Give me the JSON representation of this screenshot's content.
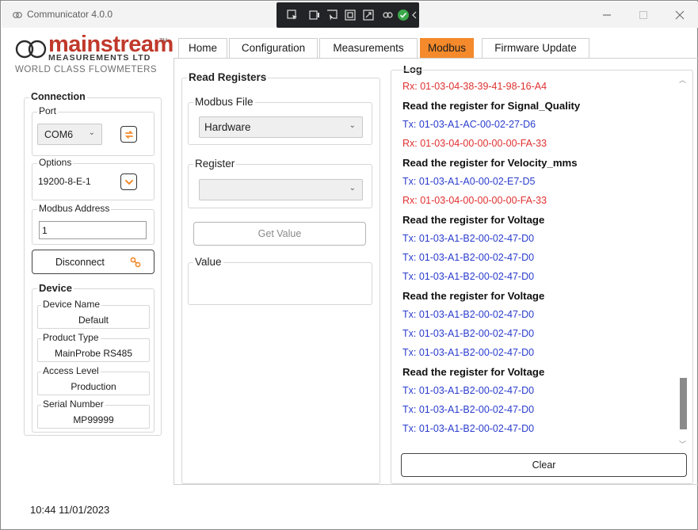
{
  "window": {
    "title": "Communicator 4.0.0"
  },
  "logo": {
    "brand": "mainstream",
    "trademark": "TM",
    "subtitle": "MEASUREMENTS LTD",
    "tagline": "WORLD CLASS FLOWMETERS"
  },
  "tabs": [
    {
      "label": "Home",
      "active": false
    },
    {
      "label": "Configuration",
      "active": false
    },
    {
      "label": "Measurements",
      "active": false
    },
    {
      "label": "Modbus",
      "active": true
    },
    {
      "label": "Firmware Update",
      "active": false
    }
  ],
  "connection": {
    "title": "Connection",
    "port_label": "Port",
    "port_value": "COM6",
    "options_label": "Options",
    "options_value": "19200-8-E-1",
    "address_label": "Modbus Address",
    "address_value": "1",
    "disconnect_label": "Disconnect"
  },
  "device": {
    "title": "Device",
    "fields": [
      {
        "label": "Device Name",
        "value": "Default"
      },
      {
        "label": "Product Type",
        "value": "MainProbe RS485"
      },
      {
        "label": "Access Level",
        "value": "Production"
      },
      {
        "label": "Serial Number",
        "value": "MP99999"
      }
    ]
  },
  "read_registers": {
    "title": "Read Registers",
    "modbus_file_label": "Modbus File",
    "modbus_file_value": "Hardware",
    "register_label": "Register",
    "register_value": "",
    "get_value_label": "Get Value",
    "value_label": "Value"
  },
  "log": {
    "title": "Log",
    "lines": [
      {
        "type": "rx",
        "text": "Rx: 01-03-04-38-39-41-98-16-A4"
      },
      {
        "type": "heading",
        "text": "Read the register for Signal_Quality"
      },
      {
        "type": "tx",
        "text": "Tx: 01-03-A1-AC-00-02-27-D6"
      },
      {
        "type": "rx",
        "text": "Rx: 01-03-04-00-00-00-00-FA-33"
      },
      {
        "type": "heading",
        "text": "Read the register for Velocity_mms"
      },
      {
        "type": "tx",
        "text": "Tx: 01-03-A1-A0-00-02-E7-D5"
      },
      {
        "type": "rx",
        "text": "Rx: 01-03-04-00-00-00-00-FA-33"
      },
      {
        "type": "heading",
        "text": "Read the register for Voltage"
      },
      {
        "type": "tx",
        "text": "Tx: 01-03-A1-B2-00-02-47-D0"
      },
      {
        "type": "tx",
        "text": "Tx: 01-03-A1-B2-00-02-47-D0"
      },
      {
        "type": "tx",
        "text": "Tx: 01-03-A1-B2-00-02-47-D0"
      },
      {
        "type": "heading",
        "text": "Read the register for Voltage"
      },
      {
        "type": "tx",
        "text": "Tx: 01-03-A1-B2-00-02-47-D0"
      },
      {
        "type": "tx",
        "text": "Tx: 01-03-A1-B2-00-02-47-D0"
      },
      {
        "type": "tx",
        "text": "Tx: 01-03-A1-B2-00-02-47-D0"
      },
      {
        "type": "heading",
        "text": "Read the register for Voltage"
      },
      {
        "type": "tx",
        "text": "Tx: 01-03-A1-B2-00-02-47-D0"
      },
      {
        "type": "tx",
        "text": "Tx: 01-03-A1-B2-00-02-47-D0"
      },
      {
        "type": "tx",
        "text": "Tx: 01-03-A1-B2-00-02-47-D0"
      }
    ],
    "clear_label": "Clear"
  },
  "status": {
    "timestamp": "10:44 11/01/2023"
  },
  "colors": {
    "accent": "#f48a2b",
    "brand": "#c0392b",
    "rx": "#e03030",
    "tx": "#2a3ccd"
  }
}
